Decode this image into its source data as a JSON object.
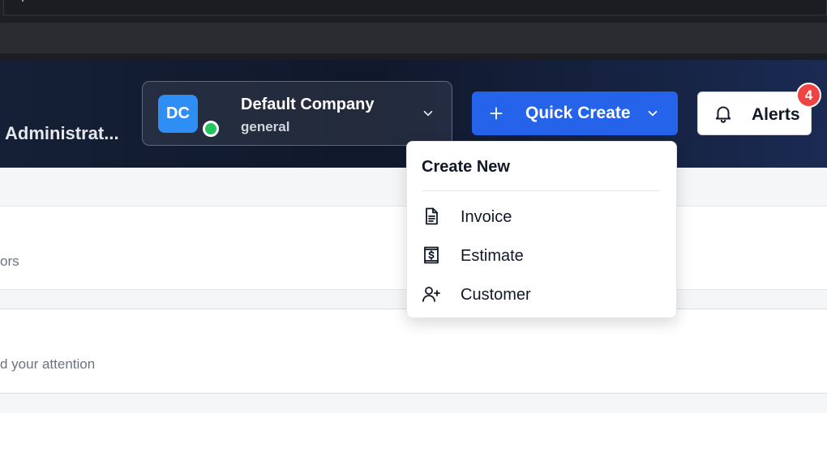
{
  "header": {
    "title": "Administrat...",
    "company": {
      "initials": "DC",
      "name": "Default Company",
      "subtitle": "general",
      "status_color": "#22c55e"
    },
    "quick_create": {
      "label": "Quick Create",
      "color": "#2563eb"
    },
    "alerts": {
      "label": "Alerts",
      "count": "4",
      "badge_color": "#ef4444"
    }
  },
  "dropdown": {
    "heading": "Create New",
    "items": [
      {
        "label": "Invoice",
        "icon": "document-icon"
      },
      {
        "label": "Estimate",
        "icon": "receipt-dollar-icon"
      },
      {
        "label": "Customer",
        "icon": "user-plus-icon"
      }
    ]
  },
  "content": {
    "panel_1_text": "ors",
    "panel_2_text": "d your attention"
  }
}
